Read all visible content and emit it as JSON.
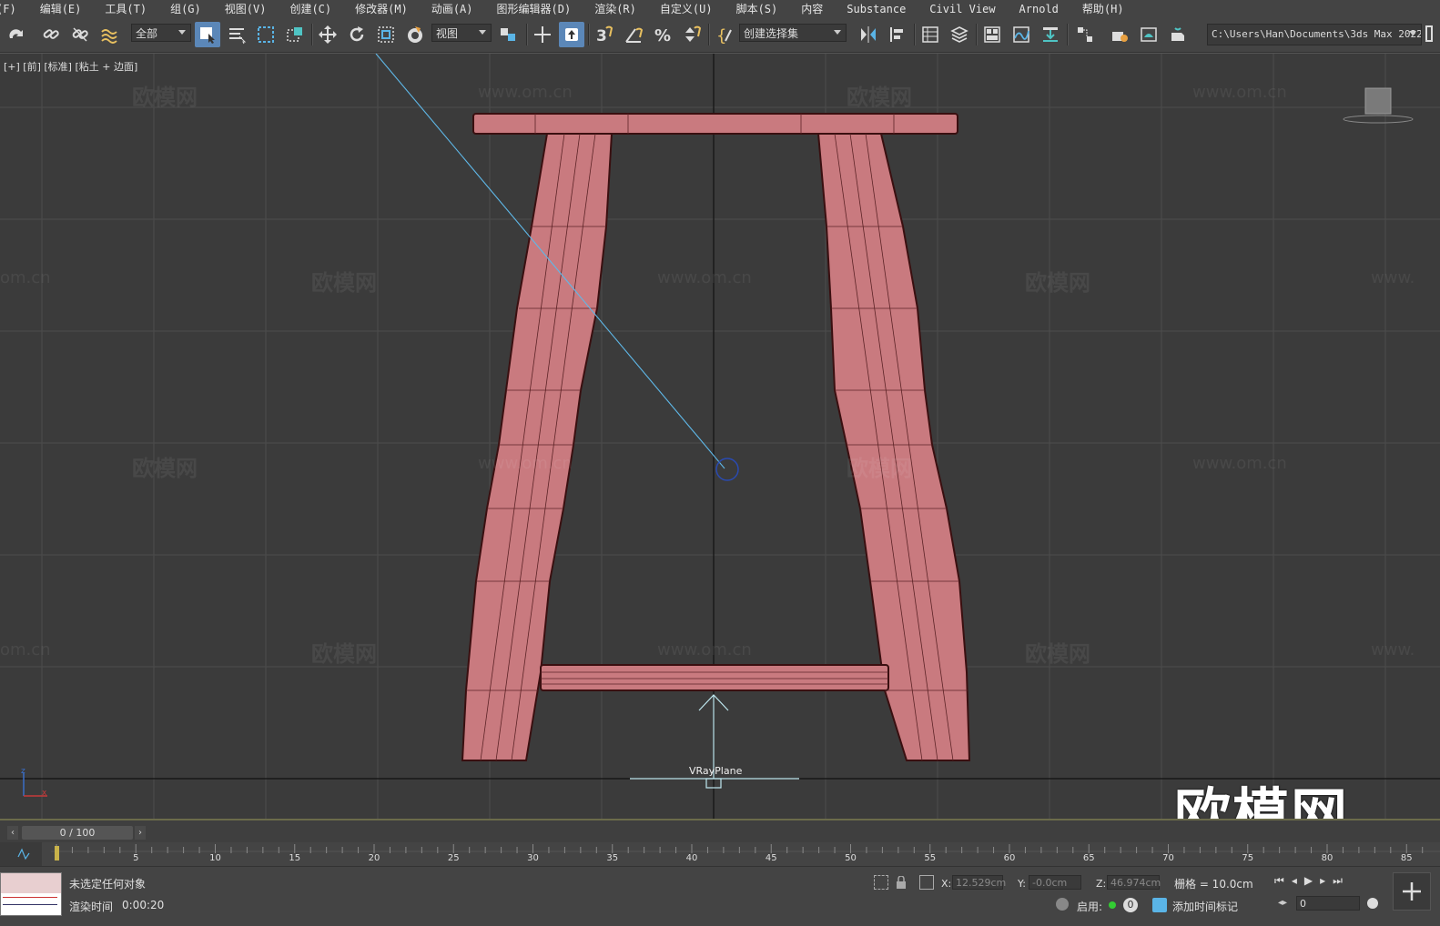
{
  "menu": [
    "(F)",
    "编辑(E)",
    "工具(T)",
    "组(G)",
    "视图(V)",
    "创建(C)",
    "修改器(M)",
    "动画(A)",
    "图形编辑器(D)",
    "渲染(R)",
    "自定义(U)",
    "脚本(S)",
    "内容",
    "Substance",
    "Civil View",
    "Arnold",
    "帮助(H)"
  ],
  "toolbar": {
    "selection_filter": "全部",
    "reference_coord": "视图",
    "named_selection": "创建选择集",
    "path": "C:\\Users\\Han\\Documents\\3ds Max 2022"
  },
  "viewport": {
    "label": "[+] [前] [标准] [粘土 + 边面]",
    "object_label": "VRayPlane",
    "watermark_cn": "欧模网",
    "watermark_url": "www.om.cn",
    "watermark_url_partial": "om.cn",
    "watermark_url_right": "www.",
    "big_watermark": "欧模网",
    "colors": {
      "model": "#c97a7f",
      "model_edge": "#3a0f10",
      "background": "#3b3b3b",
      "grid": "#4c4c4c"
    }
  },
  "timeline": {
    "frame_display": "0 / 100",
    "ticks": [
      "5",
      "10",
      "15",
      "20",
      "25",
      "30",
      "35",
      "40",
      "45",
      "50",
      "55",
      "60",
      "65",
      "70",
      "75",
      "80",
      "85"
    ]
  },
  "status": {
    "selection": "未选定任何对象",
    "render_time_label": "渲染时间",
    "render_time": "0:00:20",
    "x_label": "X:",
    "x_value": "12.529cm",
    "y_label": "Y:",
    "y_value": "-0.0cm",
    "z_label": "Z:",
    "z_value": "46.974cm",
    "grid": "栅格 = 10.0cm",
    "enable_label": "启用:",
    "enable_count": "0",
    "add_time_tag": "添加时间标记",
    "frame_field": "0"
  }
}
